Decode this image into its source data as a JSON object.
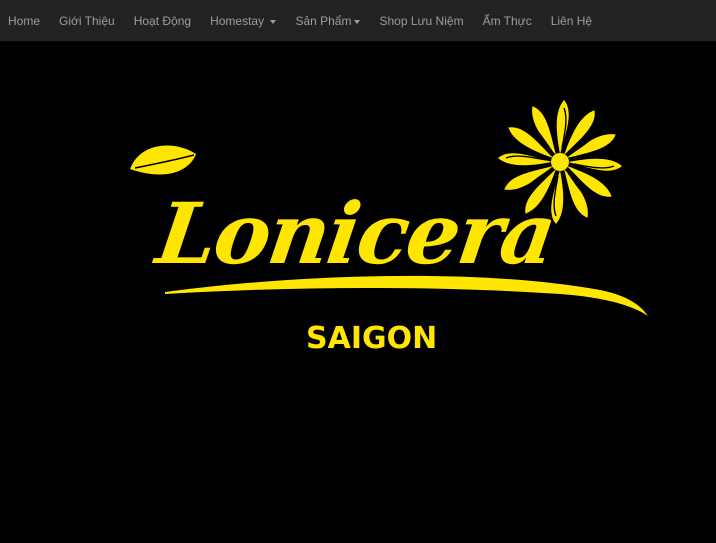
{
  "nav": {
    "items": [
      {
        "label": "Home",
        "dropdown": false
      },
      {
        "label": "Giới Thiệu",
        "dropdown": false
      },
      {
        "label": "Hoạt Động",
        "dropdown": false
      },
      {
        "label": "Homestay",
        "dropdown": true
      },
      {
        "label": "Sản Phẩm",
        "dropdown": true
      },
      {
        "label": "Shop Lưu Niệm",
        "dropdown": false
      },
      {
        "label": "Ẩm Thực",
        "dropdown": false
      },
      {
        "label": "Liên Hệ",
        "dropdown": false
      }
    ]
  },
  "logo": {
    "wordmark": "Lonicera",
    "subtitle": "SAIGON",
    "color": "#ffe600",
    "icons": [
      "leaf-icon",
      "chrysanthemum-flower-icon",
      "swoosh-underline-icon"
    ]
  },
  "colors": {
    "navbar_bg": "#222222",
    "nav_text": "#9d9d9d",
    "page_bg": "#000000"
  }
}
